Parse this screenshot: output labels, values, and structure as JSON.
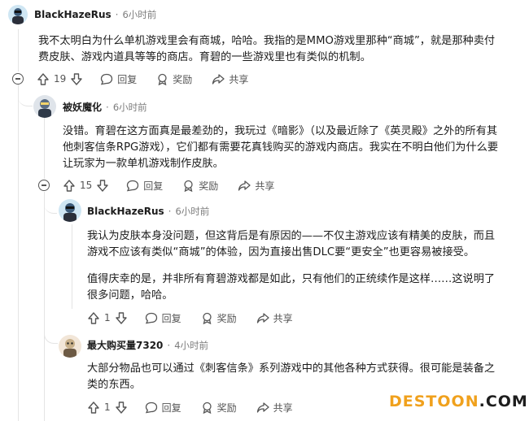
{
  "comments": [
    {
      "user": "BlackHazeRus",
      "separator": "·",
      "time": "6小时前",
      "lines": [
        "我不太明白为什么单机游戏里会有商城，哈哈。我指的是MMO游戏里那种“商城”，就是那种卖付",
        "费皮肤、游戏内道具等等的商店。育碧的一些游戏里也有类似的机制。"
      ],
      "votes": "19",
      "reply_label": "回复",
      "award_label": "奖励",
      "share_label": "共享"
    },
    {
      "user": "被妖魔化",
      "separator": "·",
      "time": "6小时前",
      "lines": [
        "没错。育碧在这方面真是最差劲的，我玩过《暗影》（以及最近除了《英灵殿》之外的所有其",
        "他刺客信条RPG游戏），它们都有需要花真钱购买的游戏内商店。我实在不明白他们为什么要",
        "让玩家为一款单机游戏制作皮肤。"
      ],
      "votes": "15",
      "reply_label": "回复",
      "award_label": "奖励",
      "share_label": "共享"
    },
    {
      "user": "BlackHazeRus",
      "separator": "·",
      "time": "6小时前",
      "lines": [
        "我认为皮肤本身没问题，但这背后是有原因的——不仅主游戏应该有精美的皮肤，而且",
        "游戏不应该有类似“商城”的体验，因为直接出售DLC要“更安全”也更容易被接受。"
      ],
      "lines2": [
        "值得庆幸的是，并非所有育碧游戏都是如此，只有他们的正统续作是这样……这说明了",
        "很多问题，哈哈。"
      ],
      "votes": "1",
      "reply_label": "回复",
      "award_label": "奖励",
      "share_label": "共享"
    },
    {
      "user": "最大购买量7320",
      "separator": "·",
      "time": "4小时前",
      "lines": [
        "大部分物品也可以通过《刺客信条》系列游戏中的其他各种方式获得。很可能是装备之",
        "类的东西。"
      ],
      "votes": "1",
      "reply_label": "回复",
      "award_label": "奖励",
      "share_label": "共享"
    }
  ],
  "watermark": {
    "part1": "DESTOON",
    "part2": ".COM",
    "color1": "#f0a11d",
    "color2": "#1d1d1d"
  },
  "colors": {
    "text": "#1c1c1c",
    "meta": "#7c7c7c",
    "thread": "#e4e4e4"
  }
}
